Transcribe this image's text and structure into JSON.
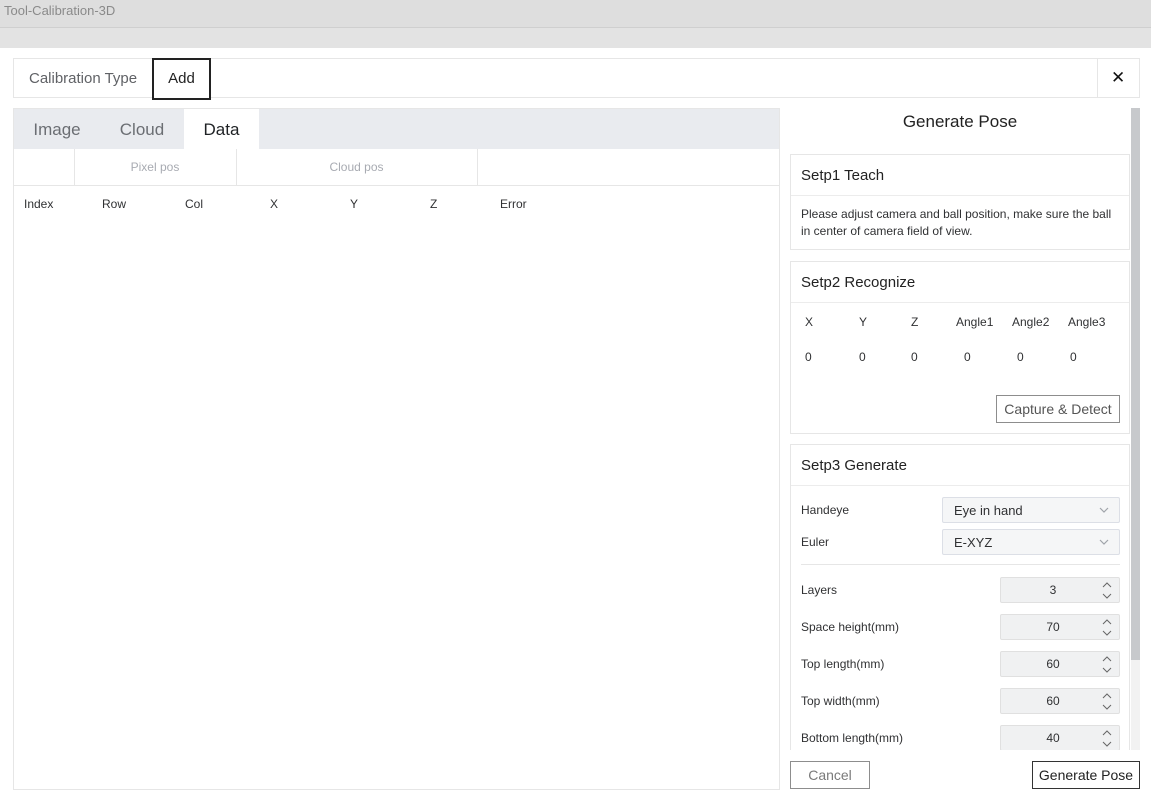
{
  "app": {
    "title": "Tool-Calibration-3D"
  },
  "header": {
    "calibration_type_label": "Calibration Type",
    "add_label": "Add",
    "close_icon": "close-icon"
  },
  "tabs": [
    {
      "label": "Image",
      "active": false
    },
    {
      "label": "Cloud",
      "active": false
    },
    {
      "label": "Data",
      "active": true
    }
  ],
  "data_table": {
    "groups": [
      "Pixel pos",
      "Cloud pos"
    ],
    "columns": [
      "Index",
      "Row",
      "Col",
      "X",
      "Y",
      "Z",
      "Error"
    ],
    "rows": []
  },
  "right_panel": {
    "title": "Generate Pose",
    "step1": {
      "title": "Setp1 Teach",
      "description": "Please adjust camera and ball position, make sure the ball in center of camera field of view."
    },
    "step2": {
      "title": "Setp2 Recognize",
      "headers": [
        "X",
        "Y",
        "Z",
        "Angle1",
        "Angle2",
        "Angle3"
      ],
      "values": [
        "0",
        "0",
        "0",
        "0",
        "0",
        "0"
      ],
      "capture_button": "Capture & Detect"
    },
    "step3": {
      "title": "Setp3 Generate",
      "handeye": {
        "label": "Handeye",
        "value": "Eye in hand"
      },
      "euler": {
        "label": "Euler",
        "value": "E-XYZ"
      },
      "layers": {
        "label": "Layers",
        "value": "3"
      },
      "space_height": {
        "label": "Space height(mm)",
        "value": "70"
      },
      "top_length": {
        "label": "Top length(mm)",
        "value": "60"
      },
      "top_width": {
        "label": "Top width(mm)",
        "value": "60"
      },
      "bottom_length": {
        "label": "Bottom length(mm)",
        "value": "40"
      }
    }
  },
  "footer": {
    "cancel_label": "Cancel",
    "generate_label": "Generate Pose"
  },
  "colors": {
    "tabbar_bg": "#e9ebef",
    "border": "#e6e6e6",
    "scroll_thumb": "#c7c9cc"
  }
}
